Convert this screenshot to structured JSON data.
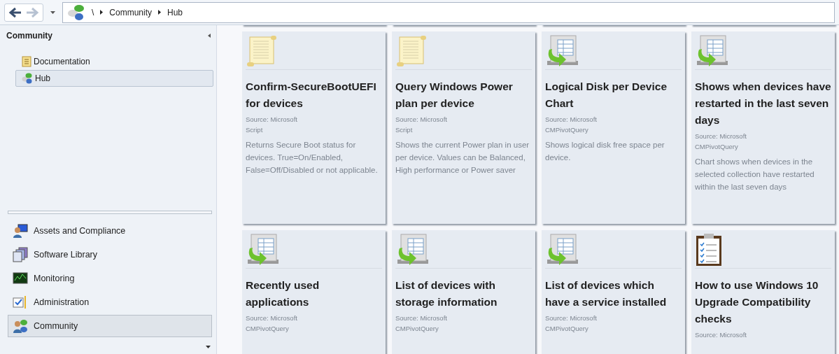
{
  "toolbar": {
    "back": {
      "disabled": false
    },
    "forward": {
      "disabled": true
    }
  },
  "breadcrumb": [
    "\\",
    "Community",
    "Hub"
  ],
  "sidebar": {
    "title": "Community",
    "tree": [
      {
        "label": "Documentation",
        "kind": "document",
        "selected": false
      },
      {
        "label": "Hub",
        "kind": "hub",
        "selected": true
      }
    ],
    "workspaces": [
      {
        "label": "Assets and Compliance",
        "kind": "assets",
        "selected": false
      },
      {
        "label": "Software Library",
        "kind": "library",
        "selected": false
      },
      {
        "label": "Monitoring",
        "kind": "monitoring",
        "selected": false
      },
      {
        "label": "Administration",
        "kind": "administration",
        "selected": false
      },
      {
        "label": "Community",
        "kind": "community",
        "selected": true
      }
    ]
  },
  "cards": [
    {
      "kind": "script",
      "title": "Confirm-SecureBootUEFI for devices",
      "source": "Source: Microsoft",
      "type": "Script",
      "description": "Returns Secure Boot status for devices. True=On/Enabled, False=Off/Disabled or not applicable."
    },
    {
      "kind": "script",
      "title": "Query Windows Power plan per device",
      "source": "Source: Microsoft",
      "type": "Script",
      "description": "Shows the current Power plan in user per device. Values can be Balanced, High performance or Power saver"
    },
    {
      "kind": "query",
      "title": "Logical Disk per Device Chart",
      "source": "Source: Microsoft",
      "type": "CMPivotQuery",
      "description": "Shows logical disk free space per device."
    },
    {
      "kind": "query",
      "title": "Shows when devices have restarted in the last seven days",
      "source": "Source: Microsoft",
      "type": "CMPivotQuery",
      "description": "Chart shows when devices in the selected collection have restarted within the last seven days"
    },
    {
      "kind": "query",
      "title": "Recently used applications",
      "source": "Source: Microsoft",
      "type": "CMPivotQuery"
    },
    {
      "kind": "query",
      "title": "List of devices with storage information",
      "source": "Source: Microsoft",
      "type": "CMPivotQuery"
    },
    {
      "kind": "query",
      "title": "List of devices which have a service installed",
      "source": "Source: Microsoft",
      "type": "CMPivotQuery"
    },
    {
      "kind": "checklist",
      "title": "How to use Windows 10 Upgrade Compatibility checks",
      "source": "Source: Microsoft"
    }
  ]
}
